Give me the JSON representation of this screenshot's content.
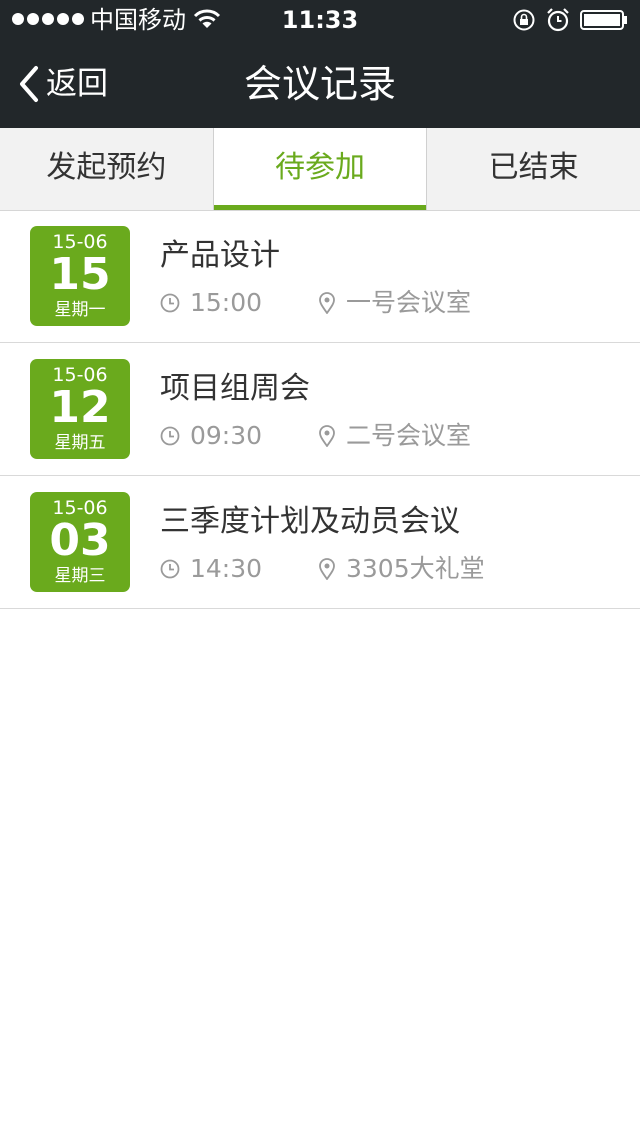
{
  "status_bar": {
    "carrier": "中国移动",
    "time": "11:33",
    "icons": [
      "signal-dots-icon",
      "wifi-icon",
      "rotation-lock-icon",
      "alarm-icon",
      "battery-icon"
    ]
  },
  "navbar": {
    "back_label": "返回",
    "title": "会议记录"
  },
  "tabs": [
    {
      "label": "发起预约",
      "active": false
    },
    {
      "label": "待参加",
      "active": true
    },
    {
      "label": "已结束",
      "active": false
    }
  ],
  "meetings": [
    {
      "date_md": "15-06",
      "day": "15",
      "weekday": "星期一",
      "title": "产品设计",
      "time": "15:00",
      "location": "一号会议室"
    },
    {
      "date_md": "15-06",
      "day": "12",
      "weekday": "星期五",
      "title": "项目组周会",
      "time": "09:30",
      "location": "二号会议室"
    },
    {
      "date_md": "15-06",
      "day": "03",
      "weekday": "星期三",
      "title": "三季度计划及动员会议",
      "time": "14:30",
      "location": "3305大礼堂"
    }
  ],
  "colors": {
    "header_bg": "#22272a",
    "accent": "#6aaa1d",
    "tab_bg": "#f2f2f2",
    "meta_text": "#9a9a9a"
  }
}
